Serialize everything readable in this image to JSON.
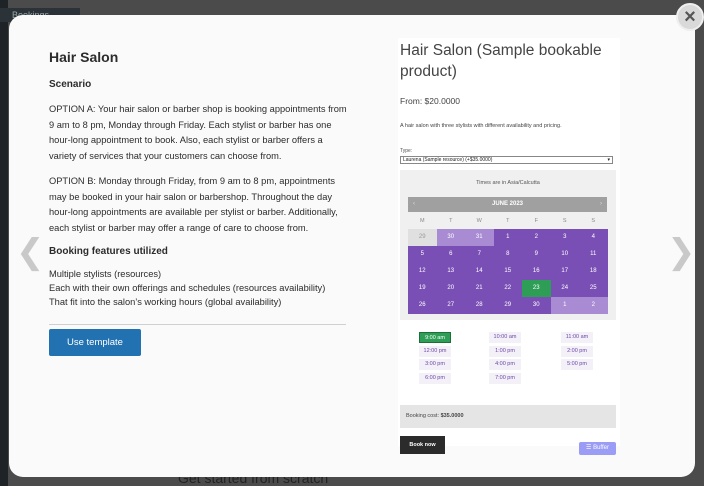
{
  "background": {
    "sidebar_label": "Bookings",
    "footer_text": "Get started from scratch"
  },
  "modal": {
    "close_symbol": "×",
    "prev_symbol": "❮",
    "next_symbol": "❯",
    "title": "Hair Salon",
    "scenario_heading": "Scenario",
    "option_a": "OPTION A: Your hair salon or barber shop is booking appointments from 9 am to 8 pm, Monday through Friday. Each stylist or barber has one hour-long appointment to book. Also, each stylist or barber offers a variety of services that your customers can choose from.",
    "option_b": "OPTION B: Monday through Friday, from 9 am to 8 pm, appointments may be booked in your hair salon or barbershop. Throughout the day hour-long appointments are available per stylist or barber. Additionally, each stylist or barber may offer a range of care to choose from.",
    "features_heading": "Booking features utilized",
    "features": [
      "Multiple stylists (resources)",
      "Each with their own offerings and schedules (resources availability)",
      "That fit into the salon’s working hours (global availability)"
    ],
    "use_template_label": "Use template"
  },
  "preview": {
    "title": "Hair Salon (Sample bookable product)",
    "price": "From: $20.0000",
    "description": "A hair salon with three stylists with different availability and pricing.",
    "type_label": "Type:",
    "type_value": "Laurena (Sample resource) (+$35.0000)",
    "timezone": "Times are in Asia/Calcutta",
    "month": "JUNE 2023",
    "prev_month": "‹",
    "next_month": "›",
    "weekdays": [
      "M",
      "T",
      "W",
      "T",
      "F",
      "S",
      "S"
    ],
    "days": [
      {
        "d": "29",
        "state": "outside"
      },
      {
        "d": "30",
        "state": "other"
      },
      {
        "d": "31",
        "state": "other"
      },
      {
        "d": "1",
        "state": "available"
      },
      {
        "d": "2",
        "state": "available"
      },
      {
        "d": "3",
        "state": "available"
      },
      {
        "d": "4",
        "state": "available"
      },
      {
        "d": "5",
        "state": "available"
      },
      {
        "d": "6",
        "state": "available"
      },
      {
        "d": "7",
        "state": "available"
      },
      {
        "d": "8",
        "state": "available"
      },
      {
        "d": "9",
        "state": "available"
      },
      {
        "d": "10",
        "state": "available"
      },
      {
        "d": "11",
        "state": "available"
      },
      {
        "d": "12",
        "state": "available"
      },
      {
        "d": "13",
        "state": "available"
      },
      {
        "d": "14",
        "state": "available"
      },
      {
        "d": "15",
        "state": "available"
      },
      {
        "d": "16",
        "state": "available"
      },
      {
        "d": "17",
        "state": "available"
      },
      {
        "d": "18",
        "state": "available"
      },
      {
        "d": "19",
        "state": "available"
      },
      {
        "d": "20",
        "state": "available"
      },
      {
        "d": "21",
        "state": "available"
      },
      {
        "d": "22",
        "state": "available"
      },
      {
        "d": "23",
        "state": "selected"
      },
      {
        "d": "24",
        "state": "available"
      },
      {
        "d": "25",
        "state": "available"
      },
      {
        "d": "26",
        "state": "available"
      },
      {
        "d": "27",
        "state": "available"
      },
      {
        "d": "28",
        "state": "available"
      },
      {
        "d": "29",
        "state": "available"
      },
      {
        "d": "30",
        "state": "available"
      },
      {
        "d": "1",
        "state": "other"
      },
      {
        "d": "2",
        "state": "other"
      }
    ],
    "colors": {
      "available": "#7a4fb5",
      "other": "#a98bd3",
      "outside": "#e0e0e0",
      "selected": "#2e9e56",
      "slot_selected": "#2e9e56"
    },
    "time_slots": [
      [
        "9:00 am",
        "10:00 am",
        "11:00 am"
      ],
      [
        "12:00 pm",
        "1:00 pm",
        "2:00 pm"
      ],
      [
        "3:00 pm",
        "4:00 pm",
        "5:00 pm"
      ],
      [
        "6:00 pm",
        "7:00 pm",
        ""
      ]
    ],
    "selected_slot": "9:00 am",
    "booking_cost_label": "Booking cost:",
    "booking_cost_value": "$35.0000",
    "book_now_label": "Book now",
    "buffer_label": "Buffer"
  }
}
